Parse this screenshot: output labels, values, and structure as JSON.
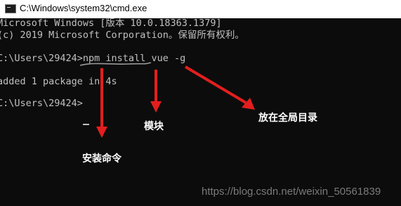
{
  "window": {
    "title": "C:\\Windows\\system32\\cmd.exe",
    "icon": "cmd-icon"
  },
  "console": {
    "lines": [
      "Microsoft Windows [版本 10.0.18363.1379]",
      "(c) 2019 Microsoft Corporation。保留所有权利。",
      "",
      "C:\\Users\\29424>npm install vue -g",
      "",
      "added 1 package in 4s",
      "",
      "C:\\Users\\29424>"
    ]
  },
  "annotations": {
    "install_command": "安装命令",
    "module": "模块",
    "global_dir": "放在全局目录"
  },
  "colors": {
    "annotation_red": "#e41e1e",
    "console_text": "#c0c0c0",
    "console_bg": "#0c0c0c"
  },
  "watermark": "https://blog.csdn.net/weixin_50561839"
}
